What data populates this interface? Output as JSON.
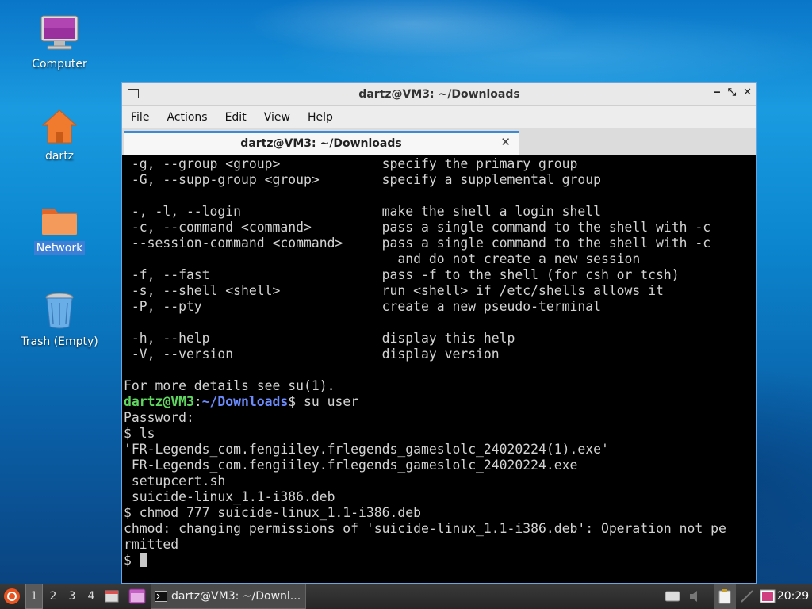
{
  "desktop": {
    "icons": [
      {
        "label": "Computer"
      },
      {
        "label": "dartz"
      },
      {
        "label": "Network"
      },
      {
        "label": "Trash (Empty)"
      }
    ]
  },
  "window": {
    "title": "dartz@VM3: ~/Downloads",
    "menu": [
      "File",
      "Actions",
      "Edit",
      "View",
      "Help"
    ],
    "tab_label": "dartz@VM3: ~/Downloads",
    "terminal": {
      "lines": [
        " -g, --group <group>             specify the primary group",
        " -G, --supp-group <group>        specify a supplemental group",
        "",
        " -, -l, --login                  make the shell a login shell",
        " -c, --command <command>         pass a single command to the shell with -c",
        " --session-command <command>     pass a single command to the shell with -c",
        "                                   and do not create a new session",
        " -f, --fast                      pass -f to the shell (for csh or tcsh)",
        " -s, --shell <shell>             run <shell> if /etc/shells allows it",
        " -P, --pty                       create a new pseudo-terminal",
        "",
        " -h, --help                      display this help",
        " -V, --version                   display version",
        "",
        "For more details see su(1)."
      ],
      "prompt_user": "dartz@VM3",
      "prompt_sep": ":",
      "prompt_path": "~/Downloads",
      "prompt_cmd": "$ su user",
      "lines_after": [
        "Password:",
        "$ ls",
        "'FR-Legends_com.fengiiley.frlegends_gameslolc_24020224(1).exe'",
        " FR-Legends_com.fengiiley.frlegends_gameslolc_24020224.exe",
        " setupcert.sh",
        " suicide-linux_1.1-i386.deb",
        "$ chmod 777 suicide-linux_1.1-i386.deb",
        "chmod: changing permissions of 'suicide-linux_1.1-i386.deb': Operation not pe",
        "rmitted"
      ],
      "last_prompt": "$ "
    }
  },
  "taskbar": {
    "workspaces": [
      "1",
      "2",
      "3",
      "4"
    ],
    "task_label": "dartz@VM3: ~/Downl...",
    "clock": "20:29"
  }
}
